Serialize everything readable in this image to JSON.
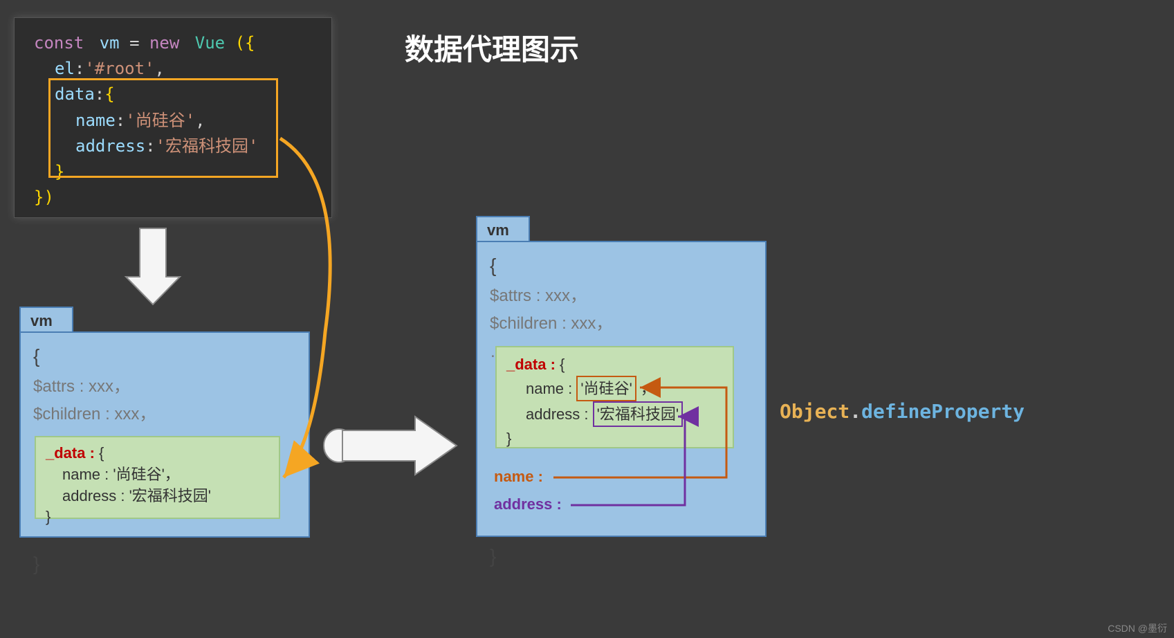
{
  "title": "数据代理图示",
  "code": {
    "const": "const",
    "vm": "vm",
    "eq": " = ",
    "new": "new",
    "Vue": "Vue",
    "open": "({",
    "el_key": "el",
    "el_val": "'#root'",
    "data_key": "data",
    "name_key": "name",
    "name_val": "'尚硅谷'",
    "addr_key": "address",
    "addr_val": "'宏福科技园'",
    "close": "})"
  },
  "vm_tab": "vm",
  "vm_content": {
    "brace_open": "{",
    "attrs": "$attrs : xxx，",
    "children": "$children : xxx，",
    "dots": "……",
    "brace_close": "}"
  },
  "data_block": {
    "label": "_data : ",
    "open": "{",
    "name_line": "name : '尚硅谷'，",
    "addr_line": "address : '宏福科技园'",
    "close": "}"
  },
  "data_block2": {
    "name_key": "name :",
    "name_val": "'尚硅谷'",
    "comma": "，",
    "addr_key": "address :",
    "addr_val": "'宏福科技园'"
  },
  "props": {
    "name": "name :",
    "address": "address :"
  },
  "side": {
    "obj": "Object",
    "dot": ".",
    "def": "defineProperty"
  },
  "watermark": "CSDN @墨衍"
}
